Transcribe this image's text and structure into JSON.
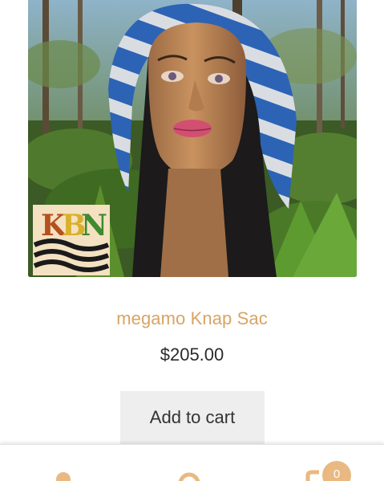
{
  "product": {
    "image_logo_text": "KBN",
    "title": "megamo Knap Sac",
    "price": "$205.00",
    "add_to_cart_label": "Add to cart"
  },
  "footer": {
    "items": [
      {
        "icon": "user-icon"
      },
      {
        "icon": "search-icon"
      },
      {
        "icon": "cart-icon"
      }
    ],
    "cart_count": "0"
  },
  "colors": {
    "title_accent": "#d8a463",
    "button_bg": "#eeeeee",
    "badge_bg": "#e9b981"
  }
}
